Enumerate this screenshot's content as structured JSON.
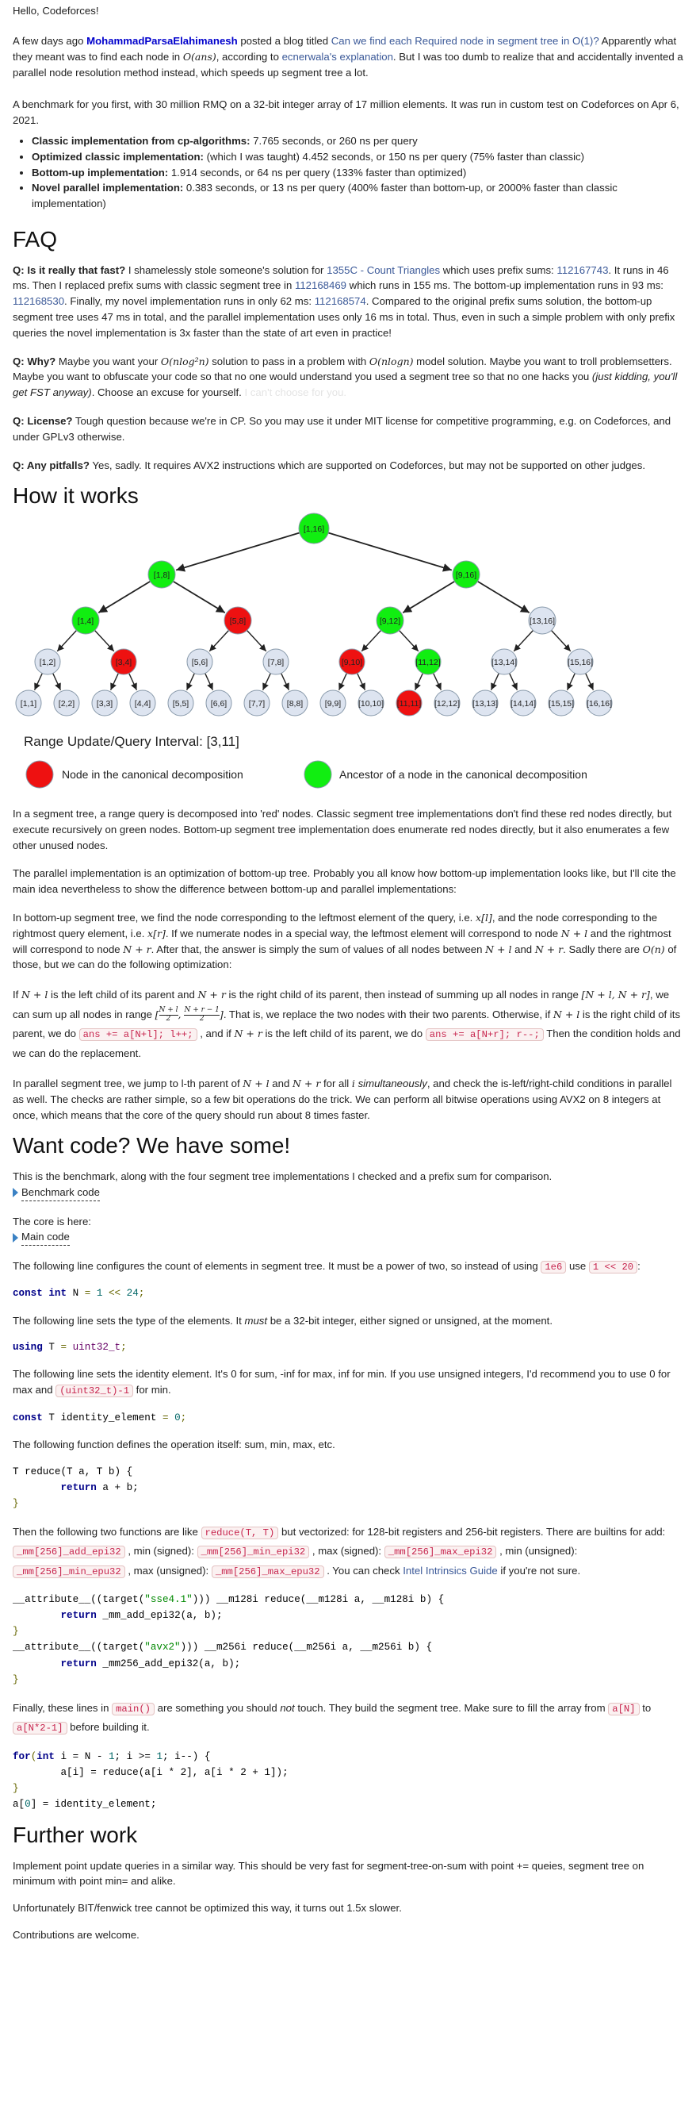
{
  "greeting": "Hello, Codeforces!",
  "intro": {
    "p1_a": "A few days ago ",
    "author": "MohammadParsaElahimanesh",
    "p1_b": " posted a blog titled ",
    "blog_link": "Can we find each Required node in segment tree in O(1)?",
    "p1_c": " Apparently what they meant was to find each node in ",
    "p1_math": "O(ans)",
    "p1_d": ", according to ",
    "expl_link": "ecnerwala's explanation",
    "p1_e": ". But I was too dumb to realize that and accidentally invented a parallel node resolution method instead, which speeds up segment tree a lot.",
    "p2": "A benchmark for you first, with 30 million RMQ on a 32-bit integer array of 17 million elements. It was run in custom test on Codeforces on Apr 6, 2021.",
    "bullets": [
      {
        "bold": "Classic implementation from cp-algorithms:",
        "rest": " 7.765 seconds, or 260 ns per query"
      },
      {
        "bold": "Optimized classic implementation:",
        "rest": " (which I was taught) 4.452 seconds, or 150 ns per query (75% faster than classic)"
      },
      {
        "bold": "Bottom-up implementation:",
        "rest": " 1.914 seconds, or 64 ns per query (133% faster than optimized)"
      },
      {
        "bold": "Novel parallel implementation:",
        "rest": " 0.383 seconds, or 13 ns per query (400% faster than bottom-up, or 2000% faster than classic implementation)"
      }
    ]
  },
  "faq": {
    "heading": "FAQ",
    "q1": {
      "q": "Q: Is it really that fast?",
      "a1": " I shamelessly stole someone's solution for ",
      "link1": "1355C - Count Triangles",
      "a2": " which uses prefix sums: ",
      "link2": "112167743",
      "a3": ". It runs in 46 ms. Then I replaced prefix sums with classic segment tree in ",
      "link3": "112168469",
      "a4": " which runs in 155 ms. The bottom-up implementation runs in 93 ms: ",
      "link4": "112168530",
      "a5": ". Finally, my novel implementation runs in only 62 ms: ",
      "link5": "112168574",
      "a6": ". Compared to the original prefix sums solution, the bottom-up segment tree uses 47 ms in total, and the parallel implementation uses only 16 ms in total. Thus, even in such a simple problem with only prefix queries the novel implementation is 3x faster than the state of art even in practice!"
    },
    "q2": {
      "q": "Q: Why?",
      "a1": " Maybe you want your ",
      "m1": "O(nlog²n)",
      "a2": " solution to pass in a problem with ",
      "m2": "O(nlogn)",
      "a3": " model solution. Maybe you want to troll problemsetters. Maybe you want to obfuscate your code so that no one would understand you used a segment tree so that no one hacks you ",
      "it": "(just kidding, you'll get FST anyway)",
      "a4": ". Choose an excuse for yourself. ",
      "faded": "I can't choose for you."
    },
    "q3": {
      "q": "Q: License?",
      "a": " Tough question because we're in CP. So you may use it under MIT license for competitive programming, e.g. on Codeforces, and under GPLv3 otherwise."
    },
    "q4": {
      "q": "Q: Any pitfalls?",
      "a": " Yes, sadly. It requires AVX2 instructions which are supported on Codeforces, but may not be supported on other judges."
    }
  },
  "how": {
    "heading": "How it works",
    "tree": {
      "legend_title": "Range Update/Query Interval: [3,11]",
      "legend_red": "Node in the canonical decomposition",
      "legend_green": "Ancestor of a node in the canonical decomposition",
      "colors": {
        "red": "#ee1111",
        "green": "#11ee11",
        "blue": "#dde4f0"
      },
      "rows": [
        [
          {
            "t": "[1,16]",
            "c": "green"
          }
        ],
        [
          {
            "t": "[1,8]",
            "c": "green"
          },
          {
            "t": "[9,16]",
            "c": "green"
          }
        ],
        [
          {
            "t": "[1,4]",
            "c": "green"
          },
          {
            "t": "[5,8]",
            "c": "red"
          },
          {
            "t": "[9,12]",
            "c": "green"
          },
          {
            "t": "[13,16]",
            "c": "blue"
          }
        ],
        [
          {
            "t": "[1,2]",
            "c": "blue"
          },
          {
            "t": "[3,4]",
            "c": "red"
          },
          {
            "t": "[5,6]",
            "c": "blue"
          },
          {
            "t": "[7,8]",
            "c": "blue"
          },
          {
            "t": "[9,10]",
            "c": "red"
          },
          {
            "t": "[11,12]",
            "c": "green"
          },
          {
            "t": "[13,14]",
            "c": "blue"
          },
          {
            "t": "[15,16]",
            "c": "blue"
          }
        ],
        [
          {
            "t": "[1,1]",
            "c": "blue"
          },
          {
            "t": "[2,2]",
            "c": "blue"
          },
          {
            "t": "[3,3]",
            "c": "blue"
          },
          {
            "t": "[4,4]",
            "c": "blue"
          },
          {
            "t": "[5,5]",
            "c": "blue"
          },
          {
            "t": "[6,6]",
            "c": "blue"
          },
          {
            "t": "[7,7]",
            "c": "blue"
          },
          {
            "t": "[8,8]",
            "c": "blue"
          },
          {
            "t": "[9,9]",
            "c": "blue"
          },
          {
            "t": "[10,10]",
            "c": "blue"
          },
          {
            "t": "[11,11]",
            "c": "red"
          },
          {
            "t": "[12,12]",
            "c": "blue"
          },
          {
            "t": "[13,13]",
            "c": "blue"
          },
          {
            "t": "[14,14]",
            "c": "blue"
          },
          {
            "t": "[15,15]",
            "c": "blue"
          },
          {
            "t": "[16,16]",
            "c": "blue"
          }
        ]
      ]
    },
    "p1": "In a segment tree, a range query is decomposed into 'red' nodes. Classic segment tree implementations don't find these red nodes directly, but execute recursively on green nodes. Bottom-up segment tree implementation does enumerate red nodes directly, but it also enumerates a few other unused nodes.",
    "p2": "The parallel implementation is an optimization of bottom-up tree. Probably you all know how bottom-up implementation looks like, but I'll cite the main idea nevertheless to show the difference between bottom-up and parallel implementations:",
    "p3": {
      "a": "In bottom-up segment tree, we find the node corresponding to the leftmost element of the query, i.e. ",
      "m1": "x[l]",
      "b": ", and the node corresponding to the rightmost query element, i.e. ",
      "m2": "x[r]",
      "c": ". If we numerate nodes in a special way, the leftmost element will correspond to node ",
      "m3": "N + l",
      "d": " and the rightmost will correspond to node ",
      "m4": "N + r",
      "e": ". After that, the answer is simply the sum of values of all nodes between ",
      "m5": "N + l",
      "f": " and ",
      "m6": "N + r",
      "g": ". Sadly there are ",
      "m7": "O(n)",
      "h": " of those, but we can do the following optimization:"
    },
    "p4": {
      "a": "If ",
      "m1": "N + l",
      "b": " is the left child of its parent and ",
      "m2": "N + r",
      "c": " is the right child of its parent, then instead of summing up all nodes in range ",
      "m3": "[N + l, N + r]",
      "d": ", we can sum up all nodes in range ",
      "f1n": "N + l",
      "f1d": "2",
      "f2n": "N + r − 1",
      "f2d": "2",
      "e": ". That is, we replace the two nodes with their two parents. Otherwise, if ",
      "m4": "N + l",
      "f": " is the right child of its parent, we do ",
      "c1": "ans += a[N+l]; l++;",
      "g": " , and if ",
      "m5": "N + r",
      "h": " is the left child of its parent, we do ",
      "c2": "ans += a[N+r]; r--;",
      "i": " Then the condition holds and we can do the replacement."
    },
    "p5": {
      "a": "In parallel segment tree, we jump to l-th parent of ",
      "m1": "N + l",
      "b": " and ",
      "m2": "N + r",
      "c": " for all ",
      "m3": "i",
      "d": " ",
      "it": "simultaneously",
      "e": ", and check the is-left/right-child conditions in parallel as well. The checks are rather simple, so a few bit operations do the trick. We can perform all bitwise operations using AVX2 on 8 integers at once, which means that the core of the query should run about 8 times faster."
    }
  },
  "code": {
    "heading": "Want code? We have some!",
    "p1": "This is the benchmark, along with the four segment tree implementations I checked and a prefix sum for comparison.",
    "spoiler1": "Benchmark code",
    "p2": "The core is here:",
    "spoiler2": "Main code",
    "p3": {
      "a": "The following line configures the count of elements in segment tree. It must be a power of two, so instead of using ",
      "c1": "1e6",
      "b": " use ",
      "c2": "1 << 20",
      "c": ":"
    },
    "p4": {
      "a": "The following line sets the type of the elements. It ",
      "it": "must",
      "b": " be a 32-bit integer, either signed or unsigned, at the moment."
    },
    "p5": {
      "a": "The following line sets the identity element. It's 0 for sum, -inf for max, inf for min. If you use unsigned integers, I'd recommend you to use 0 for max and ",
      "c1": "(uint32_t)-1",
      "b": " for min."
    },
    "p6": "The following function defines the operation itself: sum, min, max, etc.",
    "p7": {
      "a": "Then the following two functions are like ",
      "c1": "reduce(T, T)",
      "b": " but vectorized: for 128-bit registers and 256-bit registers. There are builtins for add: ",
      "c2": "_mm[256]_add_epi32",
      "c": " , min (signed): ",
      "c3": "_mm[256]_min_epi32",
      "d": " , max (signed): ",
      "c4": "_mm[256]_max_epi32",
      "e": " , min (unsigned): ",
      "c5": "_mm[256]_min_epu32",
      "f": " , max (unsigned): ",
      "c6": "_mm[256]_max_epu32",
      "g": " . You can check ",
      "link": "Intel Intrinsics Guide",
      "h": " if you're not sure."
    },
    "p8": {
      "a": "Finally, these lines in ",
      "c1": "main()",
      "b": " are something you should ",
      "it": "not",
      "c": " touch. They build the segment tree. Make sure to fill the array from ",
      "c2": "a[N]",
      "d": " to ",
      "c3": "a[N*2-1]",
      "e": " before building it."
    },
    "snip": {
      "n_kw": "const int",
      "n_rest_a": " N ",
      "n_eq": "=",
      "n_num1": " 1",
      "n_op": " <<",
      "n_num2": " 24",
      "n_semi": ";",
      "t_kw": "using",
      "t_rest": " T ",
      "t_eq": "=",
      "t_ty": " uint32_t",
      "t_semi": ";",
      "i_kw": "const",
      "i_rest": " T identity_element ",
      "i_eq": "=",
      "i_num": " 0",
      "i_semi": ";",
      "r1": "T reduce(T a, T b) {",
      "r2_kw": "return",
      "r2_rest": " a + b;",
      "r3": "}",
      "v1_a": "__attribute__((target(",
      "v1_s": "\"sse4.1\"",
      "v1_b": "))) __m128i reduce(__m128i a, __m128i b) {",
      "v2_kw": "return",
      "v2_rest": " _mm_add_epi32(a, b);",
      "v3": "}",
      "v4_a": "__attribute__((target(",
      "v4_s": "\"avx2\"",
      "v4_b": "))) __m256i reduce(__m256i a, __m256i b) {",
      "v5_kw": "return",
      "v5_rest": " _mm256_add_epi32(a, b);",
      "v6": "}",
      "b1_kw": "for",
      "b1_a": "(",
      "b1_kw2": "int",
      "b1_b": " i = N - ",
      "b1_n1": "1",
      "b1_c": "; i >= ",
      "b1_n2": "1",
      "b1_d": "; i--) {",
      "b2": "a[i] = reduce(a[i * 2], a[i * 2 + 1]);",
      "b3": "}",
      "b4_a": "a[",
      "b4_n": "0",
      "b4_b": "] = identity_element;"
    }
  },
  "further": {
    "heading": "Further work",
    "p1": "Implement point update queries in a similar way. This should be very fast for segment-tree-on-sum with point += queies, segment tree on minimum with point min= and alike.",
    "p2": "Unfortunately BIT/fenwick tree cannot be optimized this way, it turns out 1.5x slower.",
    "p3": "Contributions are welcome."
  }
}
